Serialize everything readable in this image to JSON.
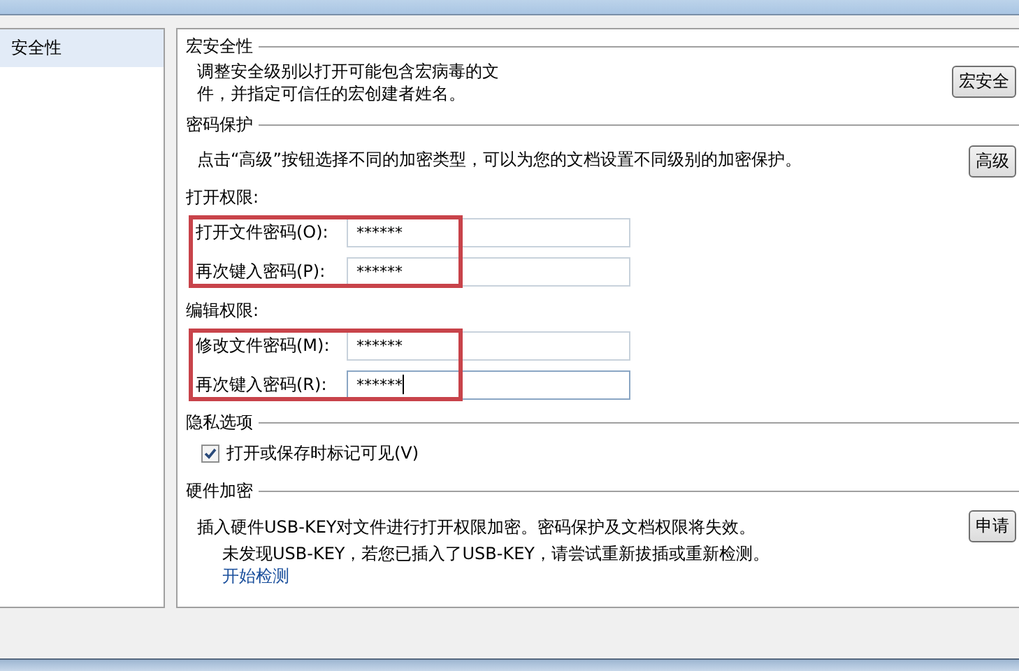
{
  "sidebar": {
    "items": [
      {
        "label": "安全性",
        "selected": true
      }
    ]
  },
  "macro": {
    "heading": "宏安全性",
    "text": "调整安全级别以打开可能包含宏病毒的文件，并指定可信任的宏创建者姓名。",
    "button": "宏安全"
  },
  "password": {
    "heading": "密码保护",
    "text": "点击“高级”按钮选择不同的加密类型，可以为您的文档设置不同级别的加密保护。",
    "button": "高级",
    "groups": [
      {
        "label": "打开权限:",
        "highlighted": true,
        "fields": [
          {
            "label": "打开文件密码(O):",
            "value": "******",
            "focused": false
          },
          {
            "label": "再次键入密码(P):",
            "value": "******",
            "focused": false
          }
        ]
      },
      {
        "label": "编辑权限:",
        "highlighted": true,
        "fields": [
          {
            "label": "修改文件密码(M):",
            "value": "******",
            "focused": false
          },
          {
            "label": "再次键入密码(R):",
            "value": "******",
            "focused": true
          }
        ]
      }
    ]
  },
  "privacy": {
    "heading": "隐私选项",
    "checkbox": {
      "label": "打开或保存时标记可见(V)",
      "checked": true
    }
  },
  "hardware": {
    "heading": "硬件加密",
    "text": "插入硬件USB-KEY对文件进行打开权限加密。密码保护及文档权限将失效。",
    "note": "未发现USB-KEY，若您已插入了USB-KEY，请尝试重新拔插或重新检测。",
    "link": "开始检测",
    "button": "申请"
  }
}
